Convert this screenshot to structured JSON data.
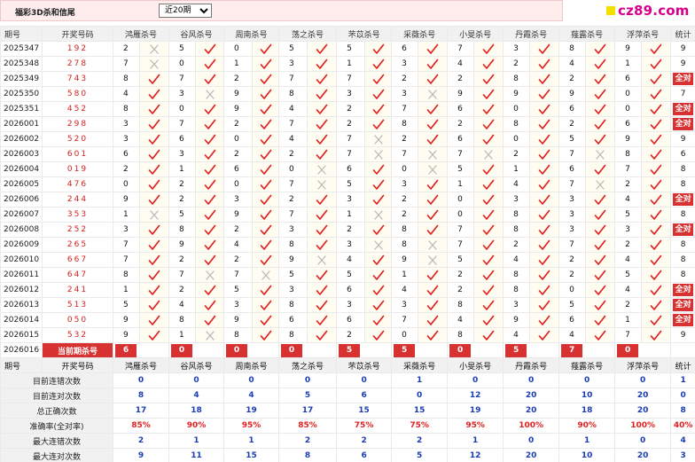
{
  "header": {
    "title": "福彩3D杀和信尾",
    "period_select": {
      "selected": "近20期",
      "options": [
        "近20期"
      ]
    },
    "logo_text": "cz89.com"
  },
  "table": {
    "col_period": "期号",
    "col_code": "开奖号码",
    "col_total": "统计",
    "experts": [
      "鸿雁杀号",
      "谷风杀号",
      "周南杀号",
      "荡之杀号",
      "芣苡杀号",
      "采薇杀号",
      "小旻杀号",
      "丹霞杀号",
      "薤露杀号",
      "浮萍杀号"
    ],
    "all_right_label": "全对",
    "rows": [
      {
        "p": "2025347",
        "c": "192",
        "n": [
          "2",
          "5",
          "0",
          "5",
          "5",
          "6",
          "7",
          "3",
          "8",
          "9"
        ],
        "r": [
          0,
          1,
          1,
          1,
          1,
          1,
          1,
          1,
          1,
          1
        ],
        "t": "9"
      },
      {
        "p": "2025348",
        "c": "278",
        "n": [
          "7",
          "0",
          "1",
          "3",
          "1",
          "3",
          "4",
          "2",
          "4",
          "1"
        ],
        "r": [
          0,
          1,
          1,
          1,
          1,
          1,
          1,
          1,
          1,
          1
        ],
        "t": "9"
      },
      {
        "p": "2025349",
        "c": "743",
        "n": [
          "8",
          "7",
          "2",
          "7",
          "7",
          "2",
          "2",
          "8",
          "2",
          "6"
        ],
        "r": [
          1,
          1,
          1,
          1,
          1,
          1,
          1,
          1,
          1,
          1
        ],
        "t": "全对"
      },
      {
        "p": "2025350",
        "c": "580",
        "n": [
          "4",
          "3",
          "9",
          "8",
          "3",
          "3",
          "9",
          "9",
          "9",
          "0"
        ],
        "r": [
          1,
          0,
          1,
          1,
          1,
          0,
          1,
          1,
          1,
          1
        ],
        "t": "7"
      },
      {
        "p": "2025351",
        "c": "452",
        "n": [
          "8",
          "0",
          "9",
          "4",
          "2",
          "7",
          "6",
          "0",
          "6",
          "0"
        ],
        "r": [
          1,
          1,
          1,
          1,
          1,
          1,
          1,
          1,
          1,
          1
        ],
        "t": "全对"
      },
      {
        "p": "2026001",
        "c": "298",
        "n": [
          "3",
          "7",
          "2",
          "7",
          "2",
          "8",
          "2",
          "8",
          "2",
          "6"
        ],
        "r": [
          1,
          1,
          1,
          1,
          1,
          1,
          1,
          1,
          1,
          1
        ],
        "t": "全对"
      },
      {
        "p": "2026002",
        "c": "520",
        "n": [
          "3",
          "6",
          "0",
          "4",
          "7",
          "2",
          "6",
          "0",
          "5",
          "9"
        ],
        "r": [
          1,
          1,
          1,
          1,
          0,
          1,
          1,
          1,
          1,
          1
        ],
        "t": "9"
      },
      {
        "p": "2026003",
        "c": "601",
        "n": [
          "6",
          "3",
          "2",
          "2",
          "7",
          "7",
          "7",
          "2",
          "7",
          "8"
        ],
        "r": [
          1,
          1,
          1,
          1,
          0,
          0,
          0,
          1,
          0,
          1
        ],
        "t": "6"
      },
      {
        "p": "2026004",
        "c": "019",
        "n": [
          "2",
          "1",
          "6",
          "0",
          "6",
          "0",
          "5",
          "1",
          "6",
          "7"
        ],
        "r": [
          1,
          1,
          1,
          0,
          1,
          0,
          1,
          1,
          1,
          1
        ],
        "t": "8"
      },
      {
        "p": "2026005",
        "c": "476",
        "n": [
          "0",
          "2",
          "0",
          "7",
          "5",
          "3",
          "1",
          "4",
          "7",
          "2"
        ],
        "r": [
          1,
          1,
          1,
          0,
          1,
          1,
          1,
          1,
          0,
          1
        ],
        "t": "8"
      },
      {
        "p": "2026006",
        "c": "244",
        "n": [
          "9",
          "2",
          "3",
          "2",
          "3",
          "2",
          "0",
          "3",
          "3",
          "4"
        ],
        "r": [
          1,
          1,
          1,
          1,
          1,
          1,
          1,
          1,
          1,
          1
        ],
        "t": "全对"
      },
      {
        "p": "2026007",
        "c": "353",
        "n": [
          "1",
          "5",
          "9",
          "7",
          "1",
          "2",
          "0",
          "8",
          "3",
          "5"
        ],
        "r": [
          0,
          1,
          1,
          1,
          0,
          1,
          1,
          1,
          1,
          1
        ],
        "t": "8"
      },
      {
        "p": "2026008",
        "c": "252",
        "n": [
          "3",
          "8",
          "2",
          "3",
          "2",
          "8",
          "7",
          "8",
          "3",
          "3"
        ],
        "r": [
          1,
          1,
          1,
          1,
          1,
          1,
          1,
          1,
          1,
          1
        ],
        "t": "全对"
      },
      {
        "p": "2026009",
        "c": "265",
        "n": [
          "7",
          "9",
          "4",
          "8",
          "3",
          "8",
          "7",
          "2",
          "7",
          "2"
        ],
        "r": [
          1,
          1,
          1,
          1,
          0,
          0,
          1,
          1,
          1,
          1
        ],
        "t": "8"
      },
      {
        "p": "2026010",
        "c": "667",
        "n": [
          "7",
          "2",
          "2",
          "9",
          "4",
          "9",
          "5",
          "4",
          "2",
          "4"
        ],
        "r": [
          1,
          1,
          1,
          0,
          1,
          0,
          1,
          1,
          1,
          1
        ],
        "t": "8"
      },
      {
        "p": "2026011",
        "c": "647",
        "n": [
          "8",
          "7",
          "7",
          "5",
          "5",
          "1",
          "2",
          "8",
          "2",
          "5"
        ],
        "r": [
          1,
          0,
          0,
          1,
          1,
          1,
          1,
          1,
          1,
          1
        ],
        "t": "8"
      },
      {
        "p": "2026012",
        "c": "241",
        "n": [
          "1",
          "2",
          "5",
          "3",
          "6",
          "4",
          "2",
          "8",
          "0",
          "4"
        ],
        "r": [
          1,
          1,
          1,
          1,
          1,
          1,
          1,
          1,
          1,
          1
        ],
        "t": "全对"
      },
      {
        "p": "2026013",
        "c": "513",
        "n": [
          "5",
          "4",
          "3",
          "8",
          "3",
          "3",
          "8",
          "3",
          "5",
          "2"
        ],
        "r": [
          1,
          1,
          1,
          1,
          1,
          1,
          1,
          1,
          1,
          1
        ],
        "t": "全对"
      },
      {
        "p": "2026014",
        "c": "050",
        "n": [
          "9",
          "8",
          "9",
          "6",
          "6",
          "7",
          "4",
          "9",
          "6",
          "1"
        ],
        "r": [
          1,
          1,
          1,
          1,
          1,
          1,
          1,
          1,
          1,
          1
        ],
        "t": "全对"
      },
      {
        "p": "2026015",
        "c": "532",
        "n": [
          "9",
          "1",
          "8",
          "8",
          "2",
          "0",
          "8",
          "4",
          "4",
          "7"
        ],
        "r": [
          1,
          0,
          1,
          1,
          1,
          1,
          1,
          1,
          1,
          1
        ],
        "t": "9"
      }
    ],
    "current": {
      "p": "2026016",
      "label": "当前期杀号",
      "n": [
        "6",
        "0",
        "0",
        "0",
        "5",
        "5",
        "0",
        "5",
        "7",
        "0"
      ]
    },
    "footer_header": {
      "col_period": "期号",
      "col_code": "开奖号码",
      "col_total": "统计"
    },
    "stats": [
      {
        "label": "目前连错次数",
        "v": [
          "0",
          "0",
          "0",
          "0",
          "0",
          "1",
          "0",
          "0",
          "0",
          "0"
        ],
        "t": "1",
        "rate": false
      },
      {
        "label": "目前连对次数",
        "v": [
          "8",
          "4",
          "4",
          "5",
          "6",
          "0",
          "12",
          "20",
          "10",
          "20"
        ],
        "t": "0",
        "rate": false
      },
      {
        "label": "总正确次数",
        "v": [
          "17",
          "18",
          "19",
          "17",
          "15",
          "15",
          "19",
          "20",
          "18",
          "20"
        ],
        "t": "8",
        "rate": false
      },
      {
        "label": "准确率(全对率)",
        "v": [
          "85%",
          "90%",
          "95%",
          "85%",
          "75%",
          "75%",
          "95%",
          "100%",
          "90%",
          "100%"
        ],
        "t": "40%",
        "rate": true
      },
      {
        "label": "最大连错次数",
        "v": [
          "2",
          "1",
          "1",
          "2",
          "2",
          "2",
          "1",
          "0",
          "1",
          "0"
        ],
        "t": "4",
        "rate": false
      },
      {
        "label": "最大连对次数",
        "v": [
          "9",
          "11",
          "15",
          "8",
          "6",
          "5",
          "12",
          "20",
          "10",
          "20"
        ],
        "t": "3",
        "rate": false
      }
    ]
  },
  "colors": {
    "accent_red": "#d83131",
    "check_red": "#e02020",
    "cross_gray": "#b9b9b9",
    "stat_blue": "#1a3cb5",
    "logo_magenta": "#d8008c"
  }
}
